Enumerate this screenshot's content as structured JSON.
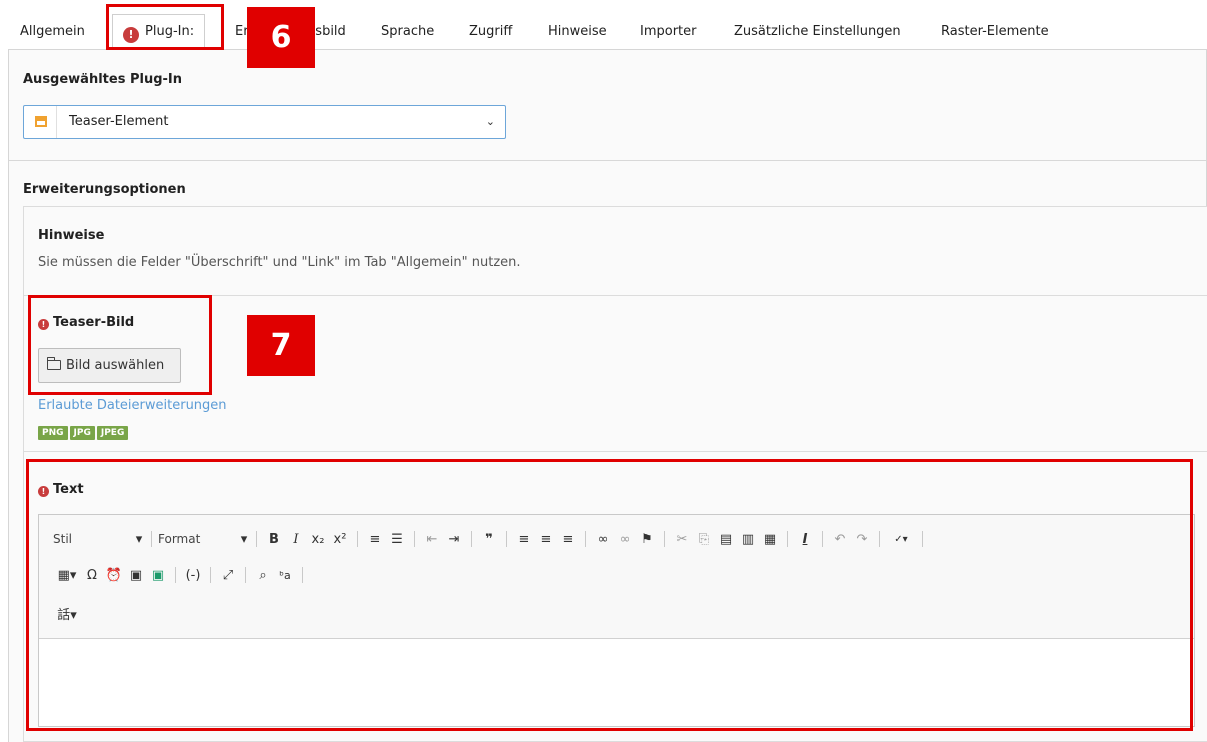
{
  "tabs": [
    {
      "label": "Allgemein"
    },
    {
      "label": "Plug-In:",
      "active": true,
      "error": true
    },
    {
      "label": "Erscheinungsbild"
    },
    {
      "label": "Sprache"
    },
    {
      "label": "Zugriff"
    },
    {
      "label": "Hinweise"
    },
    {
      "label": "Importer"
    },
    {
      "label": "Zusätzliche Einstellungen"
    },
    {
      "label": "Raster-Elemente"
    }
  ],
  "plugin": {
    "section_title": "Ausgewähltes Plug-In",
    "selected": "Teaser-Element",
    "icon": "content-element-icon"
  },
  "extension": {
    "section_title": "Erweiterungsoptionen",
    "hint_title": "Hinweise",
    "hint_text": "Sie müssen die Felder \"Überschrift\" und \"Link\" im Tab \"Allgemein\" nutzen.",
    "teaser_label": "Teaser-Bild",
    "select_button": "Bild auswählen",
    "allowed_ext_label": "Erlaubte Dateierweiterungen",
    "extensions": [
      "PNG",
      "JPG",
      "JPEG"
    ],
    "text_label": "Text"
  },
  "editor": {
    "style_combo": "Stil",
    "format_combo": "Format"
  },
  "annotations": {
    "marker_6": "6",
    "marker_7": "7"
  },
  "colors": {
    "error": "#c83c3c",
    "annotation": "#e00000",
    "badge": "#79a548",
    "link": "#5b9bd5"
  }
}
